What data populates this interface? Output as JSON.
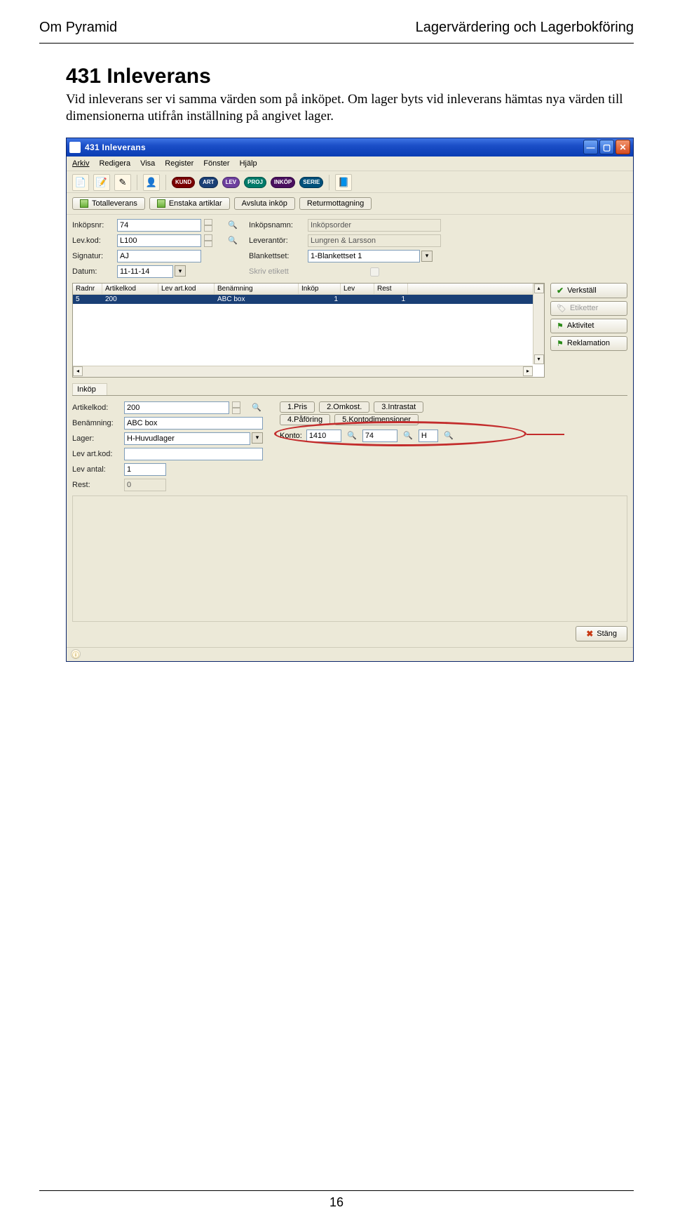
{
  "doc": {
    "header_left": "Om Pyramid",
    "header_right": "Lagervärdering och Lagerbokföring",
    "heading": "431 Inleverans",
    "paragraph": "Vid inleverans ser vi samma värden som på inköpet. Om lager byts vid inleverans hämtas nya värden till dimensionerna utifrån inställning på angivet lager.",
    "page_number": "16"
  },
  "window": {
    "title": "431 Inleverans",
    "menu": [
      "Arkiv",
      "Redigera",
      "Visa",
      "Register",
      "Fönster",
      "Hjälp"
    ],
    "toolbar_pills": [
      "KUND",
      "ART",
      "LEV",
      "PROJ",
      "INKÖP",
      "SERIE"
    ],
    "tabs": [
      "Totalleverans",
      "Enstaka artiklar",
      "Avsluta inköp",
      "Returmottagning"
    ],
    "fields": {
      "inkopsnr_label": "Inköpsnr:",
      "inkopsnr": "74",
      "inkopsnamn_label": "Inköpsnamn:",
      "inkopsnamn": "Inköpsorder",
      "levkod_label": "Lev.kod:",
      "levkod": "L100",
      "leverantor_label": "Leverantör:",
      "leverantor": "Lungren & Larsson",
      "signatur_label": "Signatur:",
      "signatur": "AJ",
      "blankettset_label": "Blankettset:",
      "blankettset": "1-Blankettset 1",
      "datum_label": "Datum:",
      "datum": "11-11-14",
      "skriv_etikett_label": "Skriv etikett"
    },
    "grid": {
      "headers": [
        "Radnr",
        "Artikelkod",
        "Lev art.kod",
        "Benämning",
        "Inköp",
        "Lev",
        "Rest"
      ],
      "row": {
        "radnr": "5",
        "artikelkod": "200",
        "levartkod": "",
        "benamning": "ABC box",
        "inkop": "1",
        "lev": "",
        "rest": "1"
      }
    },
    "sidebtns": {
      "verkstall": "Verkställ",
      "etiketter": "Etiketter",
      "aktivitet": "Aktivitet",
      "reklamation": "Reklamation"
    },
    "inkop_tab": "Inköp",
    "lower_left": {
      "artikelkod_label": "Artikelkod:",
      "artikelkod": "200",
      "benamning_label": "Benämning:",
      "benamning": "ABC box",
      "lager_label": "Lager:",
      "lager": "H-Huvudlager",
      "levartkod_label": "Lev art.kod:",
      "levartkod": "",
      "levantal_label": "Lev antal:",
      "levantal": "1",
      "rest_label": "Rest:",
      "rest": "0"
    },
    "lower_tabs": [
      "1.Pris",
      "2.Omkost.",
      "3.Intrastat",
      "4.Påföring",
      "5.Kontodimensioner"
    ],
    "konto": {
      "label": "Konto:",
      "v1": "1410",
      "v2": "74",
      "v3": "H"
    },
    "close_btn": "Stäng"
  }
}
